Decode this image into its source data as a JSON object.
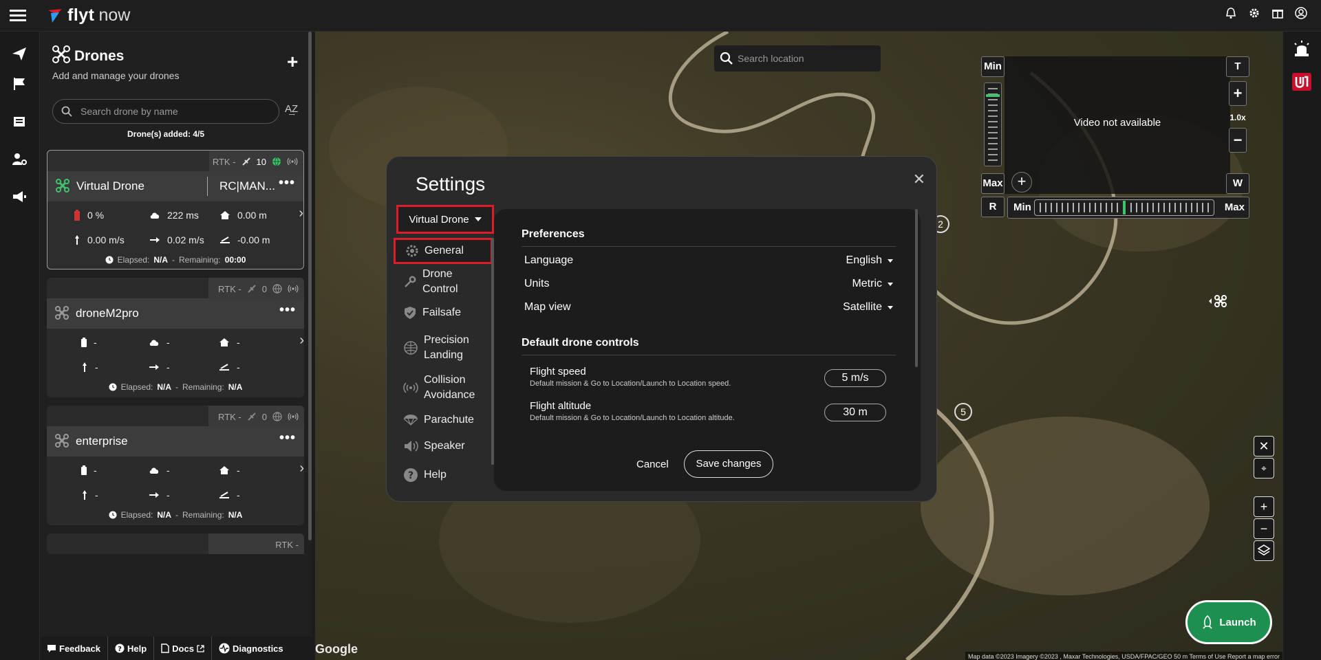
{
  "app": {
    "brand": "flyt",
    "brand2": "now"
  },
  "panel": {
    "title": "Drones",
    "subtitle": "Add and manage your drones",
    "search_placeholder": "Search drone by name",
    "sort_label": "A͢Z",
    "drones_added": "Drone(s) added: 4/5"
  },
  "drones": [
    {
      "name": "Virtual Drone",
      "rc": "RC|MAN...",
      "rtk": "RTK -",
      "sats": "10",
      "battery": "0 %",
      "latency": "222 ms",
      "home_dist": "0.00 m",
      "vspeed": "0.00 m/s",
      "hspeed": "0.02 m/s",
      "alt": "-0.00 m",
      "elapsed_label": "Elapsed:",
      "elapsed": "N/A",
      "dash": "-",
      "remaining_label": "Remaining:",
      "remaining": "00:00"
    },
    {
      "name": "droneM2pro",
      "rtk": "RTK -",
      "sats": "0",
      "battery": "-",
      "latency": "-",
      "home_dist": "-",
      "vspeed": "-",
      "hspeed": "-",
      "alt": "-",
      "elapsed_label": "Elapsed:",
      "elapsed": "N/A",
      "dash": "-",
      "remaining_label": "Remaining:",
      "remaining": "N/A"
    },
    {
      "name": "enterprise",
      "rtk": "RTK -",
      "sats": "0",
      "battery": "-",
      "latency": "-",
      "home_dist": "-",
      "vspeed": "-",
      "hspeed": "-",
      "alt": "-",
      "elapsed_label": "Elapsed:",
      "elapsed": "N/A",
      "dash": "-",
      "remaining_label": "Remaining:",
      "remaining": "N/A"
    },
    {
      "rtk": "RTK -"
    }
  ],
  "footer": {
    "feedback": "Feedback",
    "help": "Help",
    "docs": "Docs",
    "diagnostics": "Diagnostics"
  },
  "map": {
    "search_placeholder": "Search location",
    "google": "Google",
    "attribution": "Map data ©2023 Imagery ©2023 , Maxar Technologies, USDA/FPAC/GEO    50 m    Terms of Use    Report a map error",
    "waypoints": [
      "2",
      "5"
    ]
  },
  "video": {
    "not_available": "Video not available",
    "min": "Min",
    "max": "Max",
    "t": "T",
    "w": "W",
    "zoom": "1.0x",
    "plus": "+",
    "minus": "−",
    "r": "R",
    "add": "+",
    "gimbal_level": 0.85,
    "pan_level": 0.5
  },
  "map_controls": {
    "launch": "Launch"
  },
  "settings": {
    "title": "Settings",
    "drone_select": "Virtual Drone",
    "nav": [
      {
        "label": "General",
        "icon": "gear-icon"
      },
      {
        "label": "Drone Control",
        "icon": "wrench-icon"
      },
      {
        "label": "Failsafe",
        "icon": "shield-icon"
      },
      {
        "label": "Precision Landing",
        "icon": "target-icon"
      },
      {
        "label": "Collision Avoidance",
        "icon": "signal-icon"
      },
      {
        "label": "Parachute",
        "icon": "parachute-icon"
      },
      {
        "label": "Speaker",
        "icon": "speaker-icon"
      },
      {
        "label": "Help",
        "icon": "help-icon"
      }
    ],
    "preferences_title": "Preferences",
    "language_label": "Language",
    "language_value": "English",
    "units_label": "Units",
    "units_value": "Metric",
    "mapview_label": "Map view",
    "mapview_value": "Satellite",
    "controls_title": "Default drone controls",
    "flight_speed_label": "Flight speed",
    "flight_speed_desc": "Default mission & Go to Location/Launch to Location speed.",
    "flight_speed_value": "5 m/s",
    "flight_alt_label": "Flight altitude",
    "flight_alt_desc": "Default mission & Go to Location/Launch to Location altitude.",
    "flight_alt_value": "30 m",
    "cancel": "Cancel",
    "save": "Save changes"
  },
  "colors": {
    "accent_green": "#1d8f4e",
    "highlight_red": "#e01b2a",
    "drone_green": "#3ec46d"
  }
}
